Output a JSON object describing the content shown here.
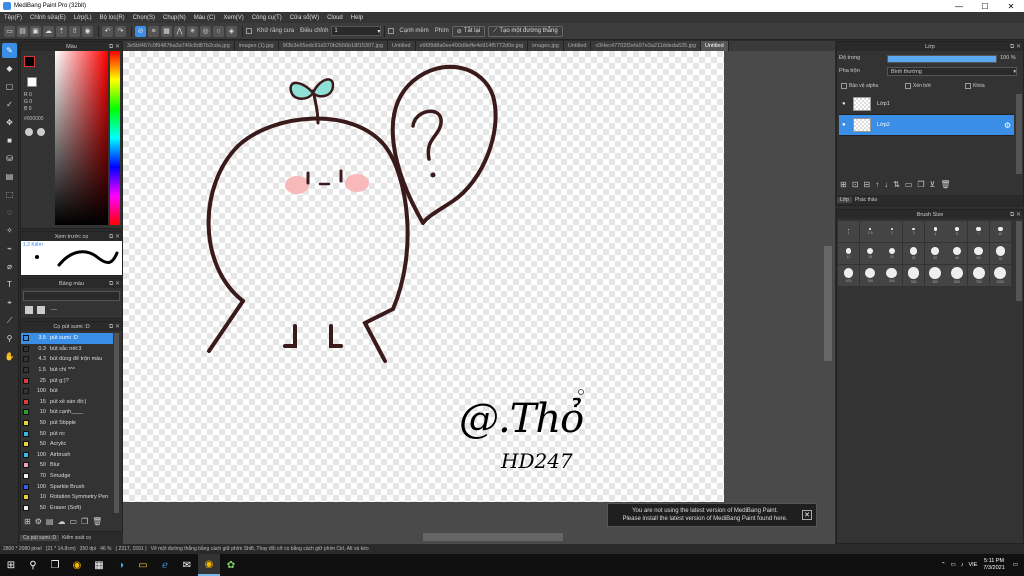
{
  "window": {
    "title": "MediBang Paint Pro (32bit)",
    "minimize": "—",
    "maximize": "☐",
    "close": "✕"
  },
  "menu": [
    "Tệp(F)",
    "Chỉnh sửa(E)",
    "Lớp(L)",
    "Bộ lọc(R)",
    "Chọn(S)",
    "Chụp(N)",
    "Màu (C)",
    "Xem(V)",
    "Công cụ(T)",
    "Cửa sổ(W)",
    "Cloud",
    "Help"
  ],
  "toolbar": {
    "antialias_label": "Khử răng cưa",
    "correction_label": "Điều chỉnh",
    "correction_value": "1",
    "edge_label": "Cạnh mềm",
    "snap_label": "Phím",
    "snap_off_label": "Tắt lại",
    "line_button": "Tạo một đường thẳng"
  },
  "doc_tabs": [
    "3e5bf467c0f9487ba3a749c8d87b2cda.jpg",
    "images (1).jpg",
    "9f3b3e65edc91d270b2666b18f15307.jpg",
    "Untitled",
    "e96f9d8a0ee490d9effe4e914f5772d0e.jpg",
    "images.jpg",
    "Untitled",
    "c0Hec47702f2efa97e3a211ddeda635.jpg",
    "Untitled"
  ],
  "color_panel": {
    "title": "Màu",
    "r_label": "R 0",
    "g_label": "G 0",
    "b_label": "B 0",
    "hex": "#000000",
    "fg_color": "#000000",
    "bg_color": "#ffffff"
  },
  "preview_panel": {
    "title": "Xem trước cọ",
    "size": "1.2 Kiểm"
  },
  "palette_panel": {
    "title": "Bảng màu",
    "value": "---"
  },
  "brush_panel": {
    "title": "Cọ pút sumi :D",
    "items": [
      {
        "size": "3.5",
        "name": "pút sumi :D",
        "color": "#3a8ee6",
        "selected": true
      },
      {
        "size": "0.3",
        "name": "bút sắc nét:3",
        "color": "#333333"
      },
      {
        "size": "4.3",
        "name": "bút dùng để trộn màu",
        "color": "#333333"
      },
      {
        "size": "1.5",
        "name": "bút chì *^*",
        "color": "#333333"
      },
      {
        "size": "25",
        "name": "pút g:)?",
        "color": "#e03a3a"
      },
      {
        "size": "100",
        "name": "bút",
        "color": "#333333"
      },
      {
        "size": "15",
        "name": "pút xề sàn đồ:)",
        "color": "#e03a3a"
      },
      {
        "size": "10",
        "name": "bút cạnh____",
        "color": "#2aa02a"
      },
      {
        "size": "50",
        "name": "pút Stipple",
        "color": "#e8d23a"
      },
      {
        "size": "50",
        "name": "pút nc",
        "color": "#3ab8e8"
      },
      {
        "size": "50",
        "name": "Acrylic",
        "color": "#e8d23a"
      },
      {
        "size": "100",
        "name": "Airbrush",
        "color": "#3ab8e8"
      },
      {
        "size": "50",
        "name": "Blur",
        "color": "#f0a0c8"
      },
      {
        "size": "70",
        "name": "Smudge",
        "color": "#eeeeee"
      },
      {
        "size": "100",
        "name": "Sparkle Brush",
        "color": "#3a5ae8"
      },
      {
        "size": "10",
        "name": "Rotation Symmetry Pen",
        "color": "#e8d23a"
      },
      {
        "size": "50",
        "name": "Eraser (Soft)",
        "color": "#eeeeee"
      }
    ],
    "tab1": "Cọ pút sumi :D",
    "tab2": "Kiểm soát cọ"
  },
  "layer_panel": {
    "title": "Lớp",
    "opacity_label": "Độ trong",
    "opacity_value": "100 %",
    "opacity_fraction": 1.0,
    "blend_label": "Pha trộn",
    "blend_value": "Bình thường",
    "protect_alpha": "Bảo vệ alpha",
    "clipping": "Xén bớt",
    "lock": "Khóa",
    "layers": [
      {
        "name": "Lớp1",
        "selected": false
      },
      {
        "name": "Lớp2",
        "selected": true
      }
    ],
    "tab1": "Lớp",
    "tab2": "Phác thảo"
  },
  "brush_size_panel": {
    "title": "Brush Size",
    "row1": [
      "1",
      "1.5",
      "2",
      "3",
      "4",
      "5",
      "7",
      "10"
    ],
    "row2": [
      "12",
      "15",
      "20",
      "25",
      "30",
      "40",
      "50",
      "70"
    ],
    "row3": [
      "100",
      "150",
      "200",
      "300",
      "400",
      "500",
      "700",
      "1000"
    ]
  },
  "canvas": {
    "signature_line1": "@.Thỏ",
    "signature_line2": "HD247"
  },
  "notice": {
    "line1": "You are not using the latest version of MediBang Paint.",
    "line2": "Please install the latest version of MediBang Paint found here."
  },
  "statusbar": {
    "size": "2800 * 2080 pixel",
    "dims": "(21 * 14.8cm)",
    "dpi": "350 dpi",
    "zoom": "46 %",
    "coords": "( 2317, 1591 )",
    "hint": "Vẽ một đường thẳng bằng cách giữ phím Shift, Thay đổi cỡ cọ bằng cách giữ phím Ctrl, Alt và kéo"
  },
  "taskbar": {
    "lang": "VIE",
    "time": "5:11 PM",
    "date": "7/3/2021"
  }
}
